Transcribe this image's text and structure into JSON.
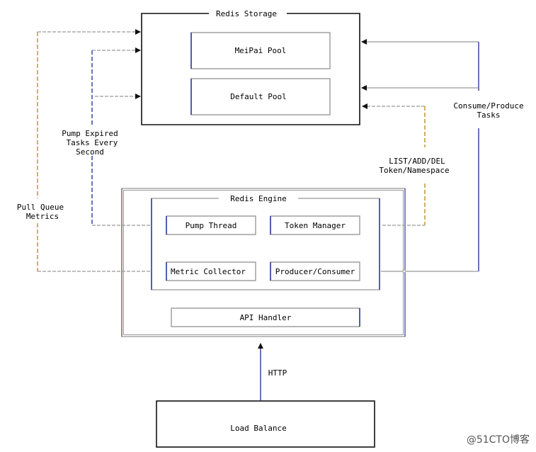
{
  "storage": {
    "title": "Redis Storage",
    "pools": [
      "MeiPai Pool",
      "Default Pool"
    ]
  },
  "engine": {
    "title": "Redis Engine",
    "components": [
      "Pump Thread",
      "Token Manager",
      "Metric Collector",
      "Producer/Consumer"
    ],
    "api": "API Handler"
  },
  "load_balance": "Load Balance",
  "edges": {
    "http": "HTTP",
    "pull_metrics": [
      "Pull Queue",
      "Metrics"
    ],
    "pump_expired": [
      "Pump Expired",
      "Tasks Every",
      "Second"
    ],
    "token_ops": [
      "LIST/ADD/DEL",
      "Token/Namespace"
    ],
    "consume_produce": [
      "Consume/Produce",
      "Tasks"
    ]
  },
  "watermark": "@51CTO博客",
  "colors": {
    "line": "#999999",
    "accent_blue": "#1a2a9a",
    "accent_yellow": "#b8860b"
  }
}
